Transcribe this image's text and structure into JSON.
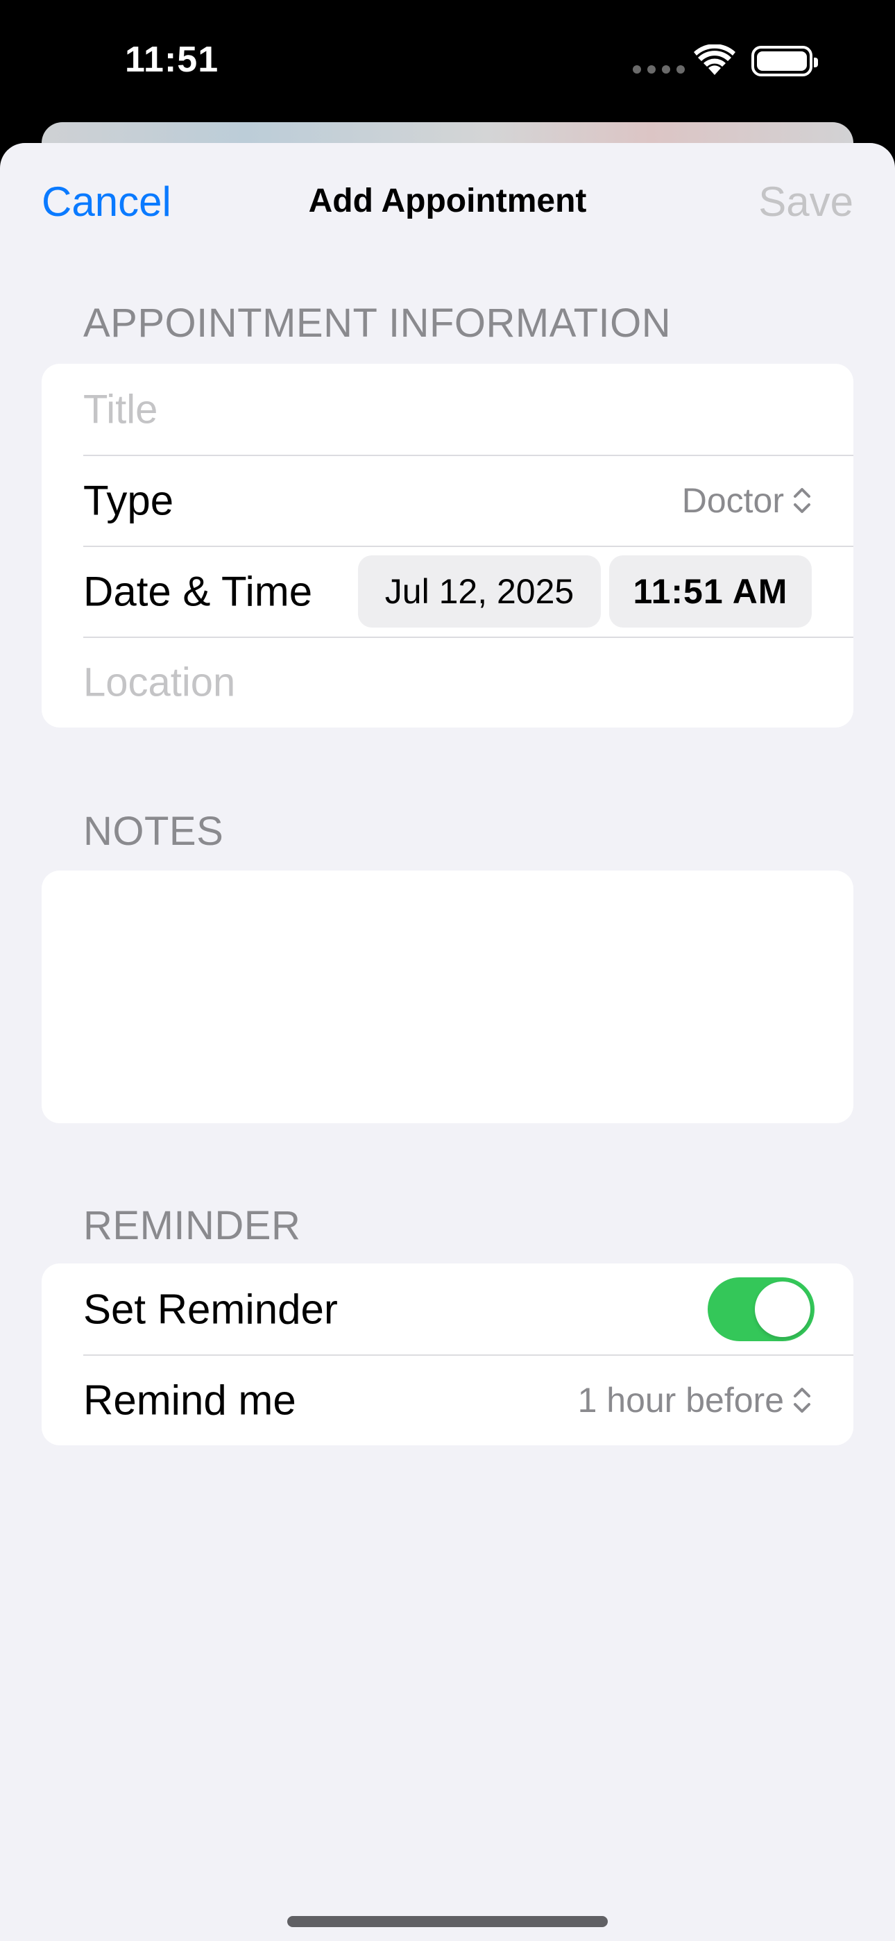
{
  "status_bar": {
    "time": "11:51"
  },
  "nav": {
    "cancel_label": "Cancel",
    "title": "Add Appointment",
    "save_label": "Save"
  },
  "appointment_info": {
    "header": "APPOINTMENT INFORMATION",
    "title_placeholder": "Title",
    "type_label": "Type",
    "type_value": "Doctor",
    "datetime_label": "Date & Time",
    "date_value": "Jul 12, 2025",
    "time_value": "11:51 AM",
    "location_placeholder": "Location"
  },
  "notes": {
    "header": "NOTES",
    "value": ""
  },
  "reminder": {
    "header": "REMINDER",
    "set_reminder_label": "Set Reminder",
    "set_reminder_on": true,
    "remind_me_label": "Remind me",
    "remind_me_value": "1 hour before"
  },
  "colors": {
    "accent": "#0a7aff",
    "toggle_on": "#34c759",
    "background": "#f2f2f7"
  }
}
